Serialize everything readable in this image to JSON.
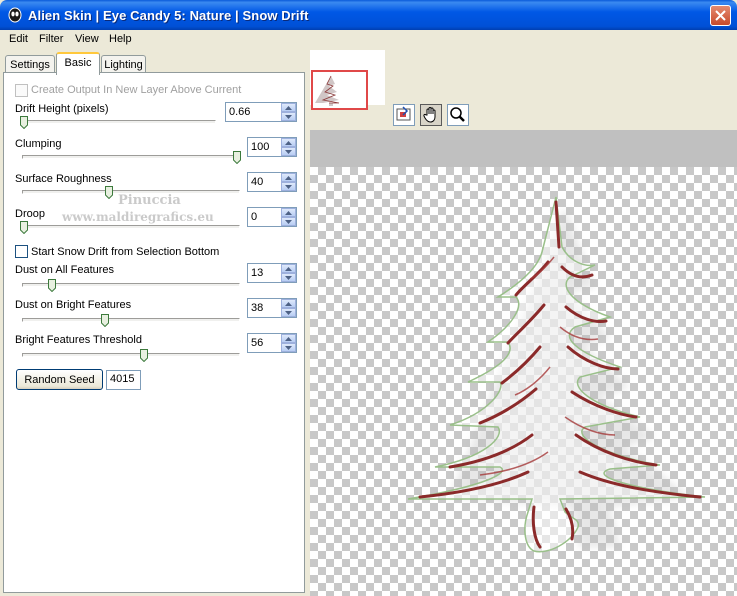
{
  "window": {
    "title": "Alien Skin | Eye Candy 5: Nature | Snow Drift",
    "colors": {
      "titlebar": "#0054e3",
      "accent_tab": "#ffc83c",
      "tree_red": "#8b2a2a",
      "tree_green": "#7aa05a",
      "preview_frame": "#e04848"
    }
  },
  "menu": [
    "Edit",
    "Filter",
    "View",
    "Help"
  ],
  "tabs": [
    {
      "label": "Settings",
      "active": false
    },
    {
      "label": "Basic",
      "active": true
    },
    {
      "label": "Lighting",
      "active": false
    }
  ],
  "options": {
    "create_output_layer": {
      "label": "Create Output In New Layer Above Current",
      "checked": false,
      "enabled": false
    },
    "start_from_selection": {
      "label": "Start Snow Drift from Selection Bottom",
      "checked": false,
      "enabled": true
    }
  },
  "params": [
    {
      "label": "Drift Height (pixels)",
      "value": "0.66",
      "slider_fraction": 0.0
    },
    {
      "label": "Clumping",
      "value": "100",
      "slider_fraction": 1.0
    },
    {
      "label": "Surface Roughness",
      "value": "40",
      "slider_fraction": 0.4
    },
    {
      "label": "Droop",
      "value": "0",
      "slider_fraction": 0.0
    },
    {
      "label": "Dust on All Features",
      "value": "13",
      "slider_fraction": 0.13
    },
    {
      "label": "Dust on Bright Features",
      "value": "38",
      "slider_fraction": 0.38
    },
    {
      "label": "Bright Features Threshold",
      "value": "56",
      "slider_fraction": 0.56
    }
  ],
  "random_seed": {
    "button_label": "Random Seed",
    "value": "4015"
  },
  "watermark": {
    "line1": "Pinuccia",
    "line2": "www.maldiregrafics.eu"
  },
  "tools": [
    {
      "name": "navigator-icon",
      "pressed": false
    },
    {
      "name": "hand-icon",
      "pressed": true
    },
    {
      "name": "zoom-icon",
      "pressed": false
    }
  ]
}
